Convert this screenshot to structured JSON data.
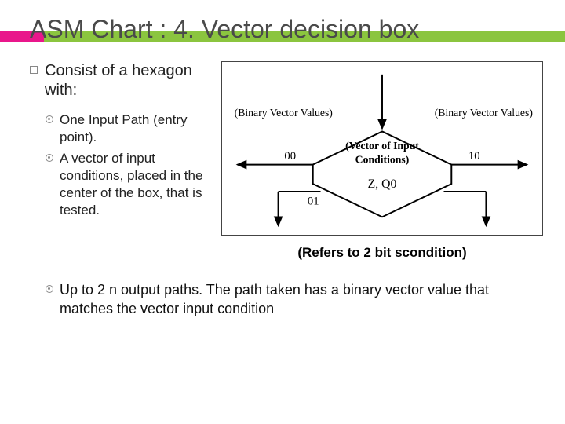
{
  "title": "ASM Chart : 4. Vector decision box",
  "lead": "Consist of a hexagon with:",
  "sub_items": [
    "One Input Path (entry point).",
    "A vector of input conditions, placed in the center of the box, that is tested."
  ],
  "caption": "(Refers to 2 bit scondition)",
  "footer": "Up to 2 n output paths. The path taken has a binary vector value that matches the vector input condition",
  "diagram": {
    "left_label": "(Binary Vector Values)",
    "right_label": "(Binary Vector Values)",
    "center_top": "(Vector of Input",
    "center_bottom": "Conditions)",
    "vars": "Z, Q0",
    "out_labels": {
      "left_top": "00",
      "left_bottom": "01",
      "right_top": "10"
    }
  }
}
